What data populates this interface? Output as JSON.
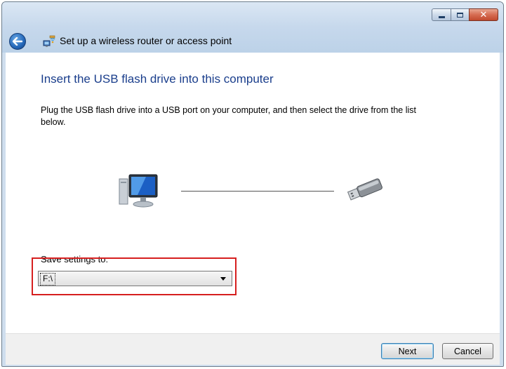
{
  "window": {
    "title": "Set up a wireless router or access point",
    "controls": {
      "minimize_icon": "minimize-icon",
      "maximize_icon": "maximize-icon",
      "close_glyph": "✕"
    },
    "back_icon": "back-arrow-icon",
    "title_icon": "wireless-network-icon"
  },
  "page": {
    "heading": "Insert the USB flash drive into this computer",
    "instruction": "Plug the USB flash drive into a USB port on your computer, and then select the drive from the list below.",
    "illustration": {
      "computer_icon": "computer-icon",
      "usb_icon": "usb-flash-drive-icon"
    },
    "save_settings": {
      "label": "Save settings to:",
      "selected": "F:\\"
    }
  },
  "footer": {
    "next_label": "Next",
    "cancel_label": "Cancel"
  },
  "colors": {
    "heading": "#1a3e8c",
    "highlight": "#d61f1f",
    "chrome": "#cfdeee"
  }
}
